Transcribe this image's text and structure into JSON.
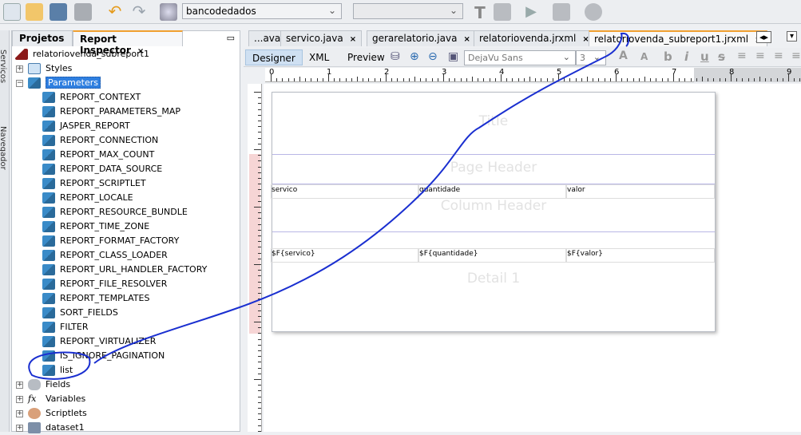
{
  "toolbar": {
    "datasource": "bancodedados",
    "second_combo": ""
  },
  "leftstrip": {
    "services": "Serviços",
    "navigator": "Navegador"
  },
  "panel": {
    "tabs": [
      {
        "label": "Projetos"
      },
      {
        "label": "Report Inspector",
        "close": "×"
      }
    ],
    "minimize": "▭",
    "root": "relatoriovenda_subreport1",
    "styles": "Styles",
    "parameters": "Parameters",
    "params": [
      "REPORT_CONTEXT",
      "REPORT_PARAMETERS_MAP",
      "JASPER_REPORT",
      "REPORT_CONNECTION",
      "REPORT_MAX_COUNT",
      "REPORT_DATA_SOURCE",
      "REPORT_SCRIPTLET",
      "REPORT_LOCALE",
      "REPORT_RESOURCE_BUNDLE",
      "REPORT_TIME_ZONE",
      "REPORT_FORMAT_FACTORY",
      "REPORT_CLASS_LOADER",
      "REPORT_URL_HANDLER_FACTORY",
      "REPORT_FILE_RESOLVER",
      "REPORT_TEMPLATES",
      "SORT_FIELDS",
      "FILTER",
      "REPORT_VIRTUALIZER",
      "IS_IGNORE_PAGINATION",
      "list"
    ],
    "fields": "Fields",
    "variables": "Variables",
    "scriptlets": "Scriptlets",
    "dataset": "dataset1"
  },
  "editor": {
    "tabs": [
      {
        "label": "...ava"
      },
      {
        "label": "servico.java",
        "close": "×"
      },
      {
        "label": "gerarelatorio.java",
        "close": "×"
      },
      {
        "label": "relatoriovenda.jrxml",
        "close": "×"
      },
      {
        "label": "relatoriovenda_subreport1.jrxml",
        "close": "×",
        "active": true
      }
    ],
    "modes": [
      "Designer",
      "XML",
      "Preview"
    ],
    "font": "DejaVu Sans",
    "size": "3",
    "ruler": [
      "0",
      "1",
      "2",
      "3",
      "4",
      "5",
      "6",
      "7",
      "8",
      "9"
    ],
    "bands": {
      "title": "Title",
      "page_header": "Page Header",
      "column_header": "Column Header",
      "detail": "Detail 1"
    },
    "columns": [
      "servico",
      "quantidade",
      "valor"
    ],
    "fields": [
      "$F{servico}",
      "$F{quantidade}",
      "$F{valor}"
    ]
  },
  "colors": {
    "selection": "#2f7fe0",
    "accent_tab": "#f0a030",
    "annotation": "#1a2fd0"
  }
}
